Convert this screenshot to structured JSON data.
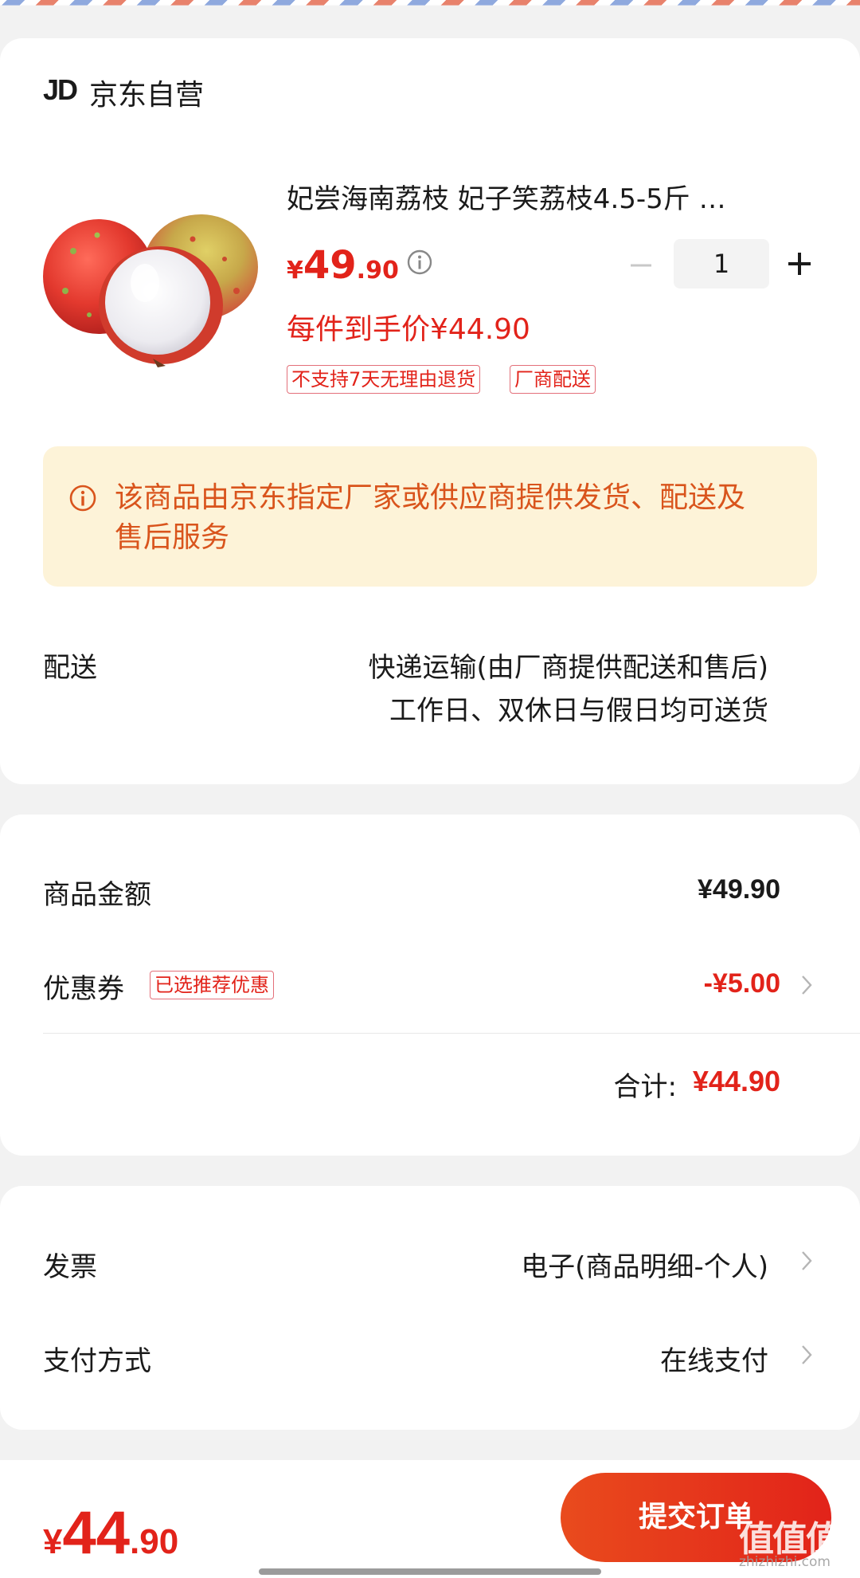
{
  "store": {
    "logo": "JD",
    "name": "京东自营"
  },
  "product": {
    "image_icon": "lychee-fruit-image",
    "title": "妃尝海南荔枝 妃子笑荔枝4.5-5斤 …",
    "price_symbol": "¥",
    "price_int": "49",
    "price_dec": ".90",
    "quantity": "1",
    "final_price": "每件到手价¥44.90",
    "tags": [
      "不支持7天无理由退货",
      "厂商配送"
    ]
  },
  "notice": {
    "text": "该商品由京东指定厂家或供应商提供发货、配送及售后服务"
  },
  "delivery": {
    "label": "配送",
    "line1": "快递运输(由厂商提供配送和售后)",
    "line2": "工作日、双休日与假日均可送货"
  },
  "summary": {
    "amount_label": "商品金额",
    "amount_value": "¥49.90",
    "coupon_label": "优惠券",
    "coupon_tag": "已选推荐优惠",
    "coupon_value": "-¥5.00",
    "total_label": "合计:",
    "total_value": "¥44.90"
  },
  "invoice": {
    "label": "发票",
    "value": "电子(商品明细-个人)"
  },
  "payment": {
    "label": "支付方式",
    "value": "在线支付"
  },
  "bottom": {
    "price_symbol": "¥",
    "price_int": "44",
    "price_dec": ".90",
    "submit_label": "提交订单"
  },
  "watermark": {
    "text": "值值值",
    "url": "zhizhizhi.com"
  },
  "colors": {
    "accent": "#e2231a",
    "notice_bg": "#fdf3d8",
    "notice_text": "#d9541c"
  }
}
